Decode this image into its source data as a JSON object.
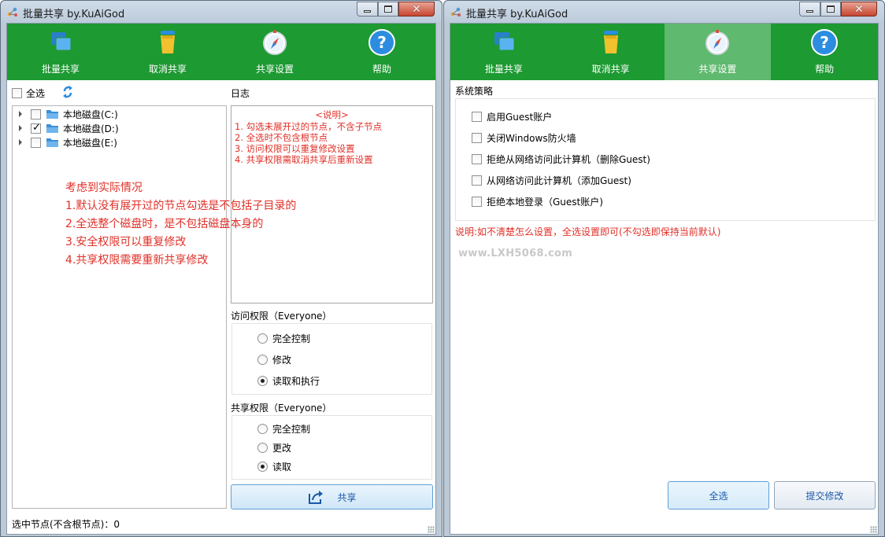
{
  "window_left": {
    "title": "批量共享 by.KuAiGod",
    "toolbar": [
      {
        "label": "批量共享",
        "icon": "share-windows-icon"
      },
      {
        "label": "取消共享",
        "icon": "trash-icon"
      },
      {
        "label": "共享设置",
        "icon": "compass-icon"
      },
      {
        "label": "帮助",
        "icon": "help-icon"
      }
    ],
    "active_tab": 0,
    "select_all_label": "全选",
    "tree": [
      {
        "label": "本地磁盘(C:)",
        "checked": false
      },
      {
        "label": "本地磁盘(D:)",
        "checked": true
      },
      {
        "label": "本地磁盘(E:)",
        "checked": false
      }
    ],
    "notes": [
      "考虑到实际情况",
      "1.默认没有展开过的节点勾选是不包括子目录的",
      "2.全选整个磁盘时，是不包括磁盘本身的",
      "3.安全权限可以重复修改",
      "4.共享权限需要重新共享修改"
    ],
    "log_label": "日志",
    "log_title": "<说明>",
    "log_lines": [
      "1. 勾选未展开过的节点，不含子节点",
      "2. 全选时不包含根节点",
      "3. 访问权限可以重复修改设置",
      "4. 共享权限需取消共享后重新设置"
    ],
    "access_label": "访问权限（Everyone）",
    "access_options": [
      "完全控制",
      "修改",
      "读取和执行"
    ],
    "access_selected": 2,
    "share_perm_label": "共享权限（Everyone）",
    "share_options": [
      "完全控制",
      "更改",
      "读取"
    ],
    "share_selected": 2,
    "share_button": "共享",
    "status": "选中节点(不含根节点)：0"
  },
  "window_right": {
    "title": "批量共享 by.KuAiGod",
    "toolbar": [
      {
        "label": "批量共享",
        "icon": "share-windows-icon"
      },
      {
        "label": "取消共享",
        "icon": "trash-icon"
      },
      {
        "label": "共享设置",
        "icon": "compass-icon"
      },
      {
        "label": "帮助",
        "icon": "help-icon"
      }
    ],
    "active_tab": 2,
    "policy_label": "系统策略",
    "policies": [
      "启用Guest账户",
      "关闭Windows防火墙",
      "拒绝从网络访问此计算机（删除Guest)",
      "从网络访问此计算机（添加Guest)",
      "拒绝本地登录（Guest账户)"
    ],
    "note": "说明:如不清楚怎么设置，全选设置即可(不勾选即保持当前默认)",
    "watermark": "www.LXH5068.com",
    "select_all_button": "全选",
    "submit_button": "提交修改"
  },
  "colors": {
    "toolbar_green": "#1d9a32",
    "toolbar_active": "#5fb96e",
    "note_red": "#e03028",
    "button_text": "#1b58a8"
  }
}
